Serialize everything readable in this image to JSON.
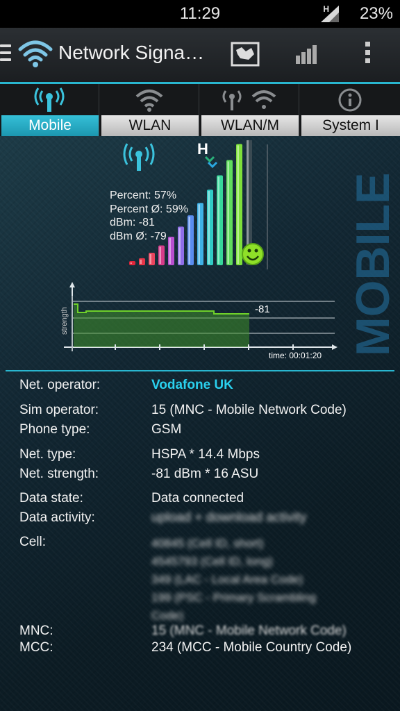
{
  "status_bar": {
    "time": "11:29",
    "network_type": "H",
    "battery": "23%"
  },
  "action_bar": {
    "title": "Network Signa…",
    "icons": [
      "menu-icon",
      "wifi-icon",
      "map-icon",
      "signal-bars-icon",
      "overflow-icon"
    ]
  },
  "tabs": [
    {
      "label": "Mobile",
      "icon": "cell-tower-icon",
      "active": true
    },
    {
      "label": "WLAN",
      "icon": "wifi-icon",
      "active": false
    },
    {
      "label": "WLAN/M",
      "icon": "tower-wifi-icon",
      "active": false
    },
    {
      "label": "System I",
      "icon": "info-icon",
      "active": false
    }
  ],
  "signal_panel": {
    "network_indicator": "H",
    "percent": "Percent: 57%",
    "percent_avg": "Percent Ø: 59%",
    "dbm": "dBm: -81",
    "dbm_avg": "dBm Ø: -79",
    "side_label": "MOBILE",
    "signal_level_bars": 12,
    "signal_level_total": 13
  },
  "graph": {
    "y_label": "strength",
    "value_label": "-81",
    "time_label": "time: 00:01:20"
  },
  "info": {
    "net_operator": {
      "label": "Net. operator:",
      "value": "Vodafone UK"
    },
    "sim_operator": {
      "label": "Sim operator:",
      "value": "15 (MNC - Mobile Network Code)"
    },
    "phone_type": {
      "label": "Phone type:",
      "value": "GSM"
    },
    "net_type": {
      "label": "Net. type:",
      "value": "HSPA * 14.4 Mbps"
    },
    "net_strength": {
      "label": "Net. strength:",
      "value": "-81 dBm * 16 ASU"
    },
    "data_state": {
      "label": "Data state:",
      "value": "Data connected"
    },
    "data_activity": {
      "label": "Data activity:",
      "value": "upload + download activity"
    },
    "cell": {
      "label": "Cell:",
      "lines": [
        "40845 (Cell ID, short)",
        "4545793 (Cell ID, long)",
        "349 (LAC - Local Area Code)",
        "199 (PSC - Primary Scrambling",
        "Code)"
      ]
    },
    "mnc": {
      "label": "MNC:",
      "value": "15 (MNC - Mobile Network Code)"
    },
    "mcc": {
      "label": "MCC:",
      "value": "234 (MCC - Mobile Country Code)"
    }
  },
  "colors": {
    "accent": "#29b6cf",
    "operator": "#2ad0ee",
    "graph_line": "#6fd12a"
  }
}
